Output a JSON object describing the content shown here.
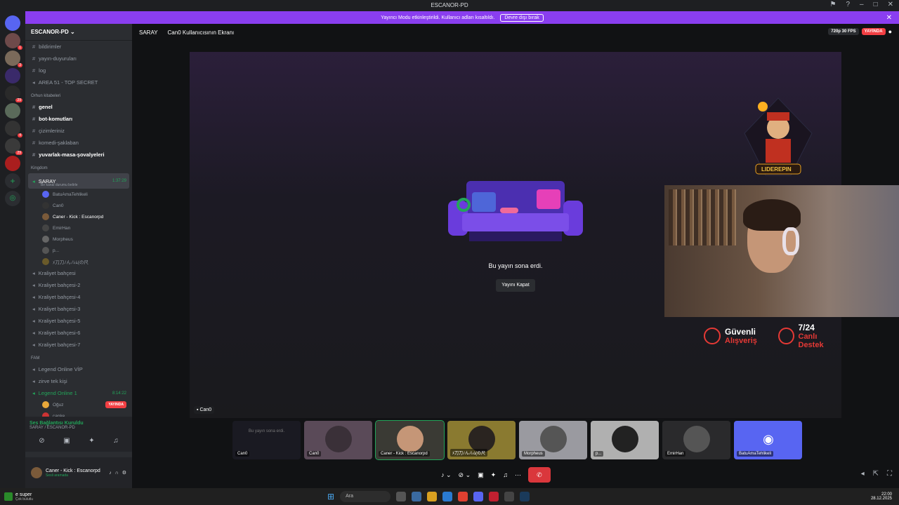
{
  "window": {
    "title": "ESCANOR-PD"
  },
  "banner": {
    "text": "Yayıncı Modu etkinleştirildi. Kullanıcı adları kısaltıldı.",
    "button": "Devre dışı bırak"
  },
  "guild": {
    "name": "ESCANOR-PD"
  },
  "channels_top": [
    "bildirimler",
    "yayın-duyuruları",
    "log",
    "AREA 51 - TOP SECRET"
  ],
  "category_1": "Orhun kitabeleri",
  "channels_cat1": [
    "genel",
    "bot-komutları",
    "çizimleriniz",
    "komedi-şaklaban",
    "yuvarlak-masa-şovalyeleri"
  ],
  "category_2": "Kingdom",
  "voice_active": {
    "name": "SARAY",
    "timer": "1:37:29",
    "status": "Bir kanal durumu belirle"
  },
  "voice_users": [
    "BatuAmaTehlikeli",
    "Can0",
    "Caner - Kick : Escanorpd",
    "EmirHan",
    "Morpheus",
    "p...",
    "ﾒ刀刀ﾉんﾉﾚﾑ(の尺"
  ],
  "voice_channels": [
    "Kraliyet bahçesi",
    "Kraliyet bahçesi-2",
    "Kraliyet bahçesi-4",
    "Kraliyet bahçesi-3",
    "Kraliyet bahçesi-5",
    "Kraliyet bahçesi-6",
    "Kraliyet bahçesi-7"
  ],
  "category_3": "FAM",
  "fam_channels": {
    "a": "Legend Online VİP",
    "b": "zirve tek kişi",
    "c": "Legend Online 1",
    "c_timer": "8:14:22",
    "users": [
      "Oğuz",
      "canke"
    ],
    "live": "YAYINDA"
  },
  "voice_conn": {
    "status": "Ses Bağlantısı Kuruldu",
    "sub": "SARAY / ESCANOR-PD"
  },
  "me": {
    "name": "Caner - Kick : Escanorpd",
    "status": "Sesli aramada"
  },
  "topbar": {
    "channel": "SARAY",
    "screen": "Can0 Kullanıcısının Ekranı",
    "quality": "720p 30 FPS",
    "live": "YAYINDA"
  },
  "stage": {
    "ended": "Bu yayın sona erdi.",
    "close": "Yayını Kapat",
    "owner": "Can0",
    "logo": "LIDEREPIN"
  },
  "promo": {
    "a_title": "Güvenli",
    "a_sub": "Alışveriş",
    "b_title": "7/24",
    "b_sub": "Canlı Destek"
  },
  "tiles": [
    "Can0",
    "Can0",
    "Caner - Kick : Escanorpd",
    "ﾒ刀刀ﾉんﾉﾚﾑ(の尺",
    "Morpheus",
    "p...",
    "EmirHan",
    "BatuAmaTehlikeli"
  ],
  "tile_ended": "Bu yayın sona erdi.",
  "taskbar": {
    "game": "e super",
    "weather": "Çok bulutlu",
    "search": "Ara",
    "time": "22:00",
    "date": "28.12.2025"
  }
}
